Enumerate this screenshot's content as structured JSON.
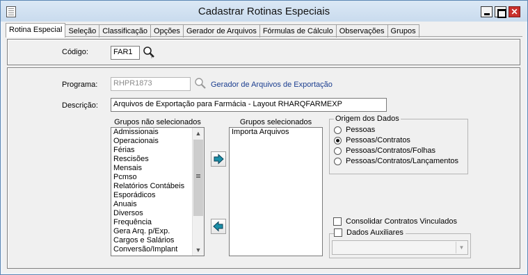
{
  "window": {
    "title": "Cadastrar Rotinas Especiais",
    "minimize": "",
    "maximize": "",
    "close": "✕"
  },
  "tabs": [
    {
      "label": "Rotina Especial",
      "active": true
    },
    {
      "label": "Seleção"
    },
    {
      "label": "Classificação"
    },
    {
      "label": "Opções"
    },
    {
      "label": "Gerador de Arquivos"
    },
    {
      "label": "Fórmulas de Cálculo"
    },
    {
      "label": "Observações"
    },
    {
      "label": "Grupos"
    }
  ],
  "codigo": {
    "label": "Código:",
    "value": "FAR1"
  },
  "programa": {
    "label": "Programa:",
    "value": "RHPR1873",
    "link": "Gerador de Arquivos de Exportação"
  },
  "descricao": {
    "label": "Descrição:",
    "value": "Arquivos de Exportação para Farmácia - Layout RHARQFARMEXP"
  },
  "nao_selecionados": {
    "caption": "Grupos não selecionados",
    "items": [
      "Admissionais",
      "Operacionais",
      "Férias",
      "Rescisões",
      "Mensais",
      "Pcmso",
      "Relatórios Contábeis",
      "Esporádicos",
      "Anuais",
      "Diversos",
      "Frequência",
      "Gera Arq. p/Exp.",
      "Cargos e Salários",
      "Conversão/Implant"
    ]
  },
  "selecionados": {
    "caption": "Grupos selecionados",
    "items": [
      "Importa Arquivos"
    ]
  },
  "origem": {
    "legend": "Origem dos Dados",
    "options": [
      {
        "label": "Pessoas",
        "checked": false
      },
      {
        "label": "Pessoas/Contratos",
        "checked": true
      },
      {
        "label": "Pessoas/Contratos/Folhas",
        "checked": false
      },
      {
        "label": "Pessoas/Contratos/Lançamentos",
        "checked": false
      }
    ]
  },
  "consolidar": {
    "label": "Consolidar Contratos Vinculados",
    "checked": false
  },
  "dados_auxiliares": {
    "label": "Dados Auxiliares",
    "checked": false,
    "value": ""
  },
  "colors": {
    "accent": "#1a3d8f",
    "close": "#c9302c",
    "arrow": "#1b8fa8"
  }
}
